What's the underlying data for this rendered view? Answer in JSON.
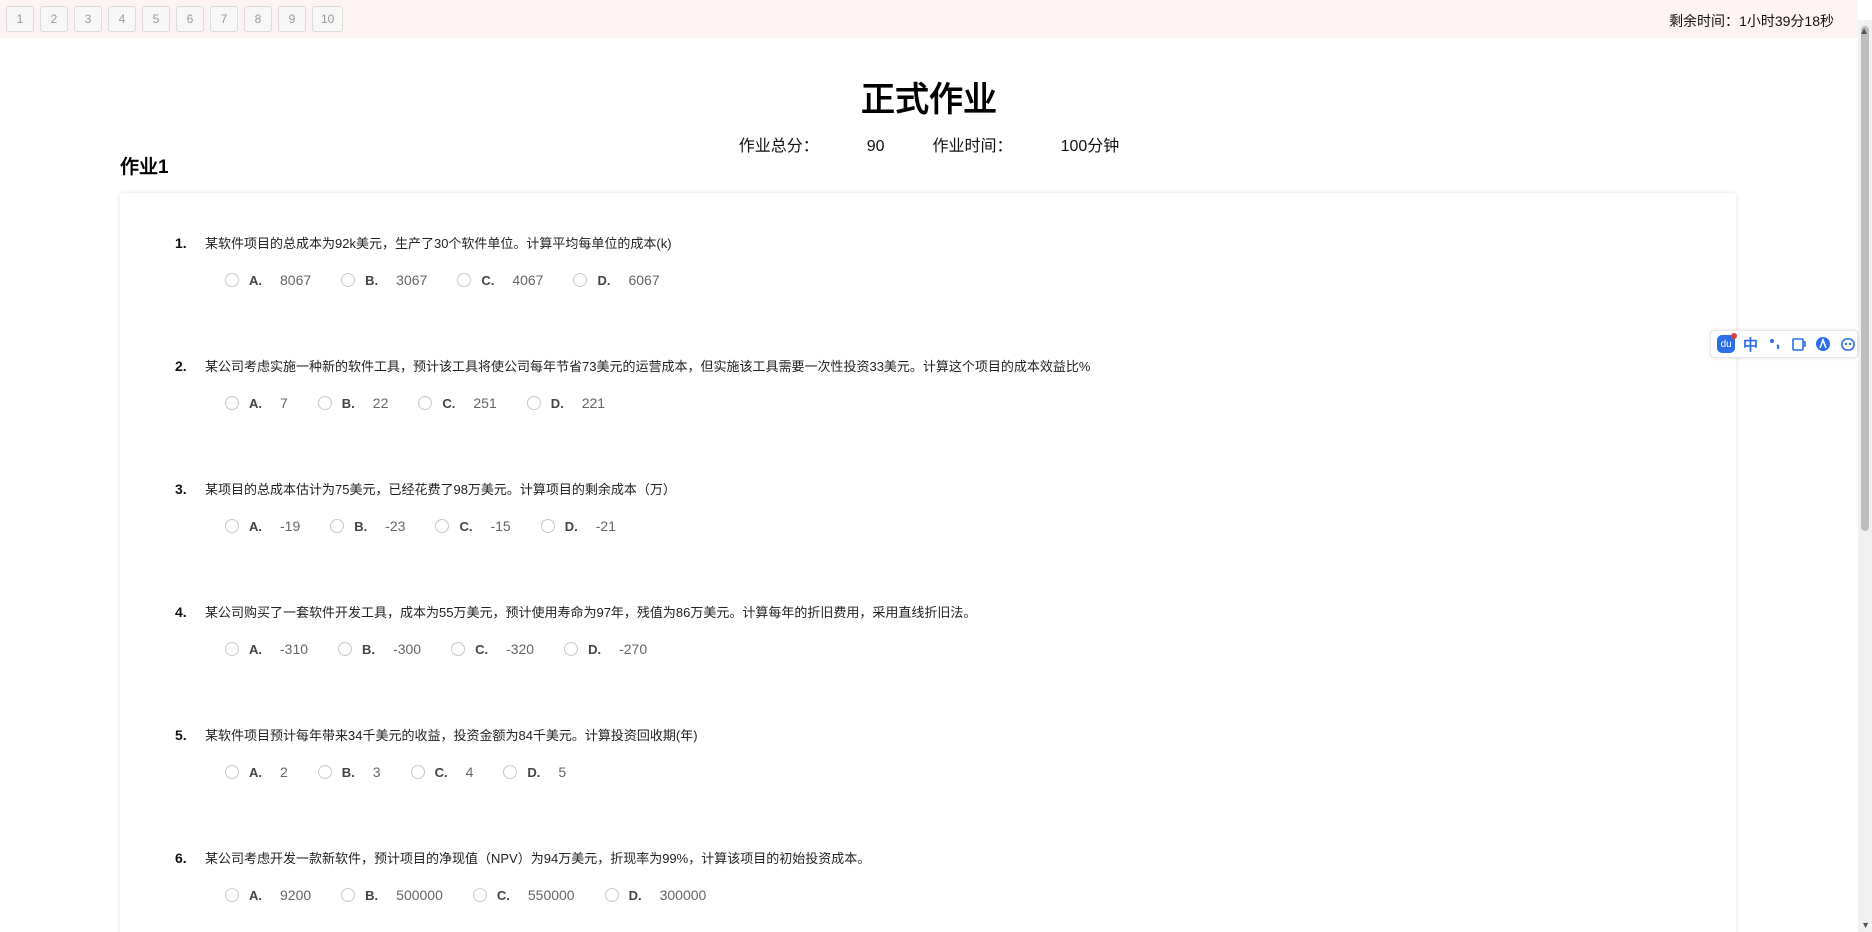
{
  "nav": {
    "question_buttons": [
      "1",
      "2",
      "3",
      "4",
      "5",
      "6",
      "7",
      "8",
      "9",
      "10"
    ],
    "timer_label": "剩余时间：",
    "timer_value": "1小时39分18秒"
  },
  "header": {
    "title": "正式作业",
    "total_score_label": "作业总分：",
    "total_score_value": "90",
    "time_label": "作业时间：",
    "time_value": "100分钟"
  },
  "section": {
    "title": "作业1"
  },
  "questions": [
    {
      "number": "1.",
      "text": "某软件项目的总成本为92k美元，生产了30个软件单位。计算平均每单位的成本(k)",
      "options": [
        {
          "letter": "A.",
          "value": "8067"
        },
        {
          "letter": "B.",
          "value": "3067"
        },
        {
          "letter": "C.",
          "value": "4067"
        },
        {
          "letter": "D.",
          "value": "6067"
        }
      ]
    },
    {
      "number": "2.",
      "text": "某公司考虑实施一种新的软件工具，预计该工具将使公司每年节省73美元的运营成本，但实施该工具需要一次性投资33美元。计算这个项目的成本效益比%",
      "options": [
        {
          "letter": "A.",
          "value": "7"
        },
        {
          "letter": "B.",
          "value": "22"
        },
        {
          "letter": "C.",
          "value": "251"
        },
        {
          "letter": "D.",
          "value": "221"
        }
      ]
    },
    {
      "number": "3.",
      "text": "某项目的总成本估计为75美元，已经花费了98万美元。计算项目的剩余成本（万）",
      "options": [
        {
          "letter": "A.",
          "value": "-19"
        },
        {
          "letter": "B.",
          "value": "-23"
        },
        {
          "letter": "C.",
          "value": "-15"
        },
        {
          "letter": "D.",
          "value": "-21"
        }
      ]
    },
    {
      "number": "4.",
      "text": "某公司购买了一套软件开发工具，成本为55万美元，预计使用寿命为97年，残值为86万美元。计算每年的折旧费用，采用直线折旧法。",
      "options": [
        {
          "letter": "A.",
          "value": "-310"
        },
        {
          "letter": "B.",
          "value": "-300"
        },
        {
          "letter": "C.",
          "value": "-320"
        },
        {
          "letter": "D.",
          "value": "-270"
        }
      ]
    },
    {
      "number": "5.",
      "text": "某软件项目预计每年带来34千美元的收益，投资金额为84千美元。计算投资回收期(年)",
      "options": [
        {
          "letter": "A.",
          "value": "2"
        },
        {
          "letter": "B.",
          "value": "3"
        },
        {
          "letter": "C.",
          "value": "4"
        },
        {
          "letter": "D.",
          "value": "5"
        }
      ]
    },
    {
      "number": "6.",
      "text": "某公司考虑开发一款新软件，预计项目的净现值（NPV）为94万美元，折现率为99%，计算该项目的初始投资成本。",
      "options": [
        {
          "letter": "A.",
          "value": "9200"
        },
        {
          "letter": "B.",
          "value": "500000"
        },
        {
          "letter": "C.",
          "value": "550000"
        },
        {
          "letter": "D.",
          "value": "300000"
        }
      ]
    }
  ],
  "toolbar": {
    "logo_text": "du",
    "chinese_label": "中",
    "icons": [
      "baidu-logo-icon",
      "chinese-input-icon",
      "punctuation-icon",
      "clipboard-icon",
      "user-icon",
      "robot-icon"
    ]
  },
  "colors": {
    "topbar_bg": "#fdf3f3",
    "accent": "#2a6ee8",
    "badge": "#e5383b"
  }
}
